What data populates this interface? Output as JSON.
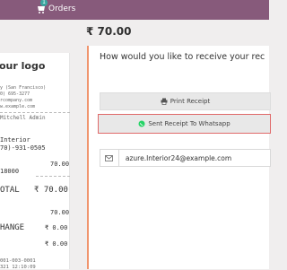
{
  "topbar": {
    "orders_label": "Orders",
    "orders_badge": "1",
    "color": "#875a7b"
  },
  "amount_due": "₹ 70.00",
  "receipt": {
    "logo": "our logo",
    "company_lines": [
      "y (San Francisco)",
      "0) 695-3277",
      "rcompany.com",
      "w.example.com"
    ],
    "served_by": "Mitchell Admin",
    "customer_name": "Interior",
    "customer_phone": "70)-931-0505",
    "product_code": "18000",
    "product_amount": "70.00",
    "total_label": "OTAL",
    "total_value": "₹ 70.00",
    "paid_amount": "70.00",
    "change_label": "HANGE",
    "change_value": "₹ 0.00",
    "tax_amount": "₹ 0.00",
    "order_ref": "001-003-0001",
    "datetime": "321 12:10:09"
  },
  "receive": {
    "question": "How would you like to receive your rec",
    "print_label": "Print Receipt",
    "whatsapp_label": "Sent Receipt To Whatsapp",
    "email_value": "azure.Interior24@example.com",
    "accent": "#f0956e",
    "highlight": "#e06a6a"
  }
}
